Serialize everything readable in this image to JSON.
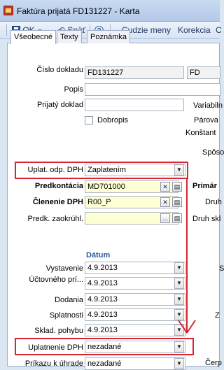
{
  "window": {
    "title": "Faktúra prijatá FD131227 - Karta"
  },
  "toolbar": {
    "ok": "OK",
    "back": "Späť",
    "currencies": "Cudzie meny",
    "correction": "Korekcia",
    "more": "C"
  },
  "tabs": [
    "Všeobecné",
    "Texty",
    "Poznámka"
  ],
  "fields": {
    "cislo_dokladu": {
      "label": "Číslo dokladu",
      "value": "FD131227",
      "series": "FD"
    },
    "popis": {
      "label": "Popis",
      "value": ""
    },
    "prijaty_doklad": {
      "label": "Prijatý doklad",
      "value": ""
    },
    "dobropis": {
      "label": "Dobropis"
    },
    "uplat_odp_dph": {
      "label": "Uplat. odp. DPH",
      "value": "Zaplatením"
    },
    "predkontacia": {
      "label": "Predkontácia",
      "value": "MD701000"
    },
    "clenenie_dph": {
      "label": "Členenie DPH",
      "value": "R00_P"
    },
    "predk_zaokruhl": {
      "label": "Predk. zaokrúhl.",
      "value": ""
    },
    "datum_header": "Dátum",
    "vystavenie": {
      "label": "Vystavenie",
      "value": "4.9.2013"
    },
    "uctovneho": {
      "label": "Účtovného prí...",
      "value": "4.9.2013"
    },
    "dodania": {
      "label": "Dodania",
      "value": "4.9.2013"
    },
    "splatnosti": {
      "label": "Splatnosti",
      "value": "4.9.2013"
    },
    "sklad_pohybu": {
      "label": "Sklad. pohybu",
      "value": "4.9.2013"
    },
    "uplatnenie_dph": {
      "label": "Uplatnenie DPH",
      "value": "nezadané"
    },
    "prikazu_k_uhrade": {
      "label": "Príkazu k úhrade",
      "value": "nezadané"
    }
  },
  "right_labels": [
    "Variabiln",
    "Párova",
    "Konštant",
    "Spôso",
    "Primár",
    "Druh",
    "Druh skl",
    "S",
    "Z",
    "Čerp"
  ],
  "colors": {
    "highlight": "#d7262f",
    "section": "#2c5aa0",
    "required": "#ffffd6"
  }
}
